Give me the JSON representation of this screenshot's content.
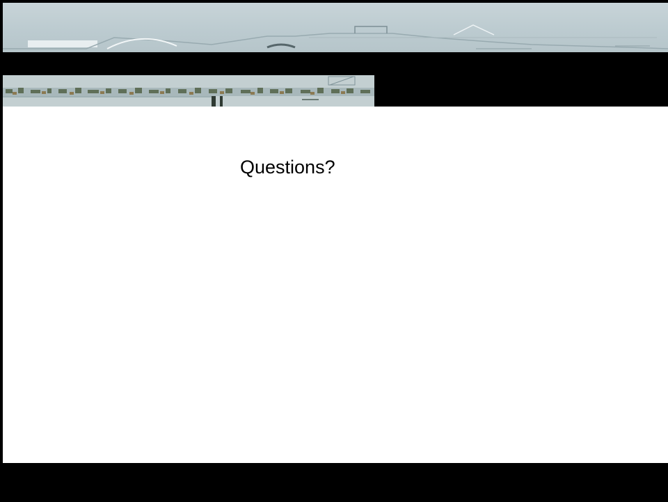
{
  "slide": {
    "title": "Questions?"
  },
  "colors": {
    "frame": "#000000",
    "top_band": "#c3cfd1",
    "content_background": "#ffffff",
    "text": "#000000"
  }
}
